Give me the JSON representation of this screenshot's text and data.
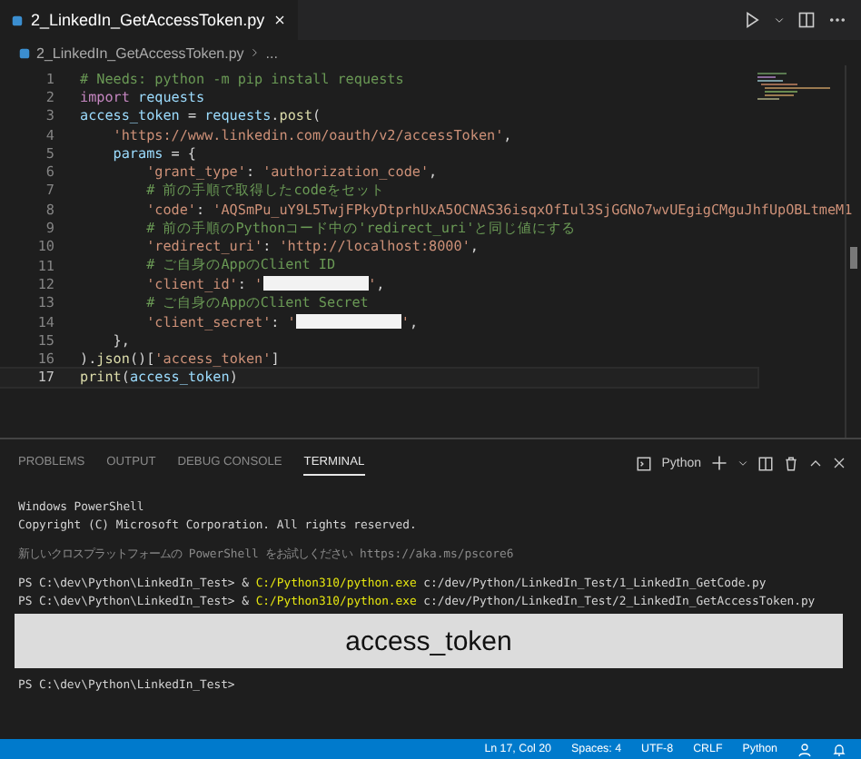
{
  "editor_tab": {
    "title": "2_LinkedIn_GetAccessToken.py",
    "selected": true
  },
  "breadcrumb": {
    "file": "2_LinkedIn_GetAccessToken.py",
    "more": "..."
  },
  "code_lines": [
    {
      "number": "1",
      "current": false,
      "parts": [
        {
          "kind": "comment",
          "text": "# Needs: python -m pip install requests"
        }
      ]
    },
    {
      "number": "2",
      "current": false,
      "parts": [
        {
          "kind": "keyword",
          "text": "import"
        },
        {
          "kind": "space"
        },
        {
          "kind": "name",
          "text": "requests"
        }
      ]
    },
    {
      "number": "3",
      "current": false,
      "parts": [
        {
          "kind": "name",
          "text": "access_token"
        },
        {
          "kind": "plain",
          "text": " = "
        },
        {
          "kind": "name",
          "text": "requests"
        },
        {
          "kind": "plain",
          "text": "."
        },
        {
          "kind": "function",
          "text": "post"
        },
        {
          "kind": "plain",
          "text": "("
        }
      ]
    },
    {
      "number": "4",
      "current": false,
      "parts": [
        {
          "kind": "indent"
        },
        {
          "kind": "string",
          "text": "'https://www.linkedin.com/oauth/v2/accessToken'"
        },
        {
          "kind": "plain",
          "text": ","
        }
      ]
    },
    {
      "number": "5",
      "current": false,
      "parts": [
        {
          "kind": "indent"
        },
        {
          "kind": "name",
          "text": "params"
        },
        {
          "kind": "plain",
          "text": " = {"
        }
      ]
    },
    {
      "number": "6",
      "current": false,
      "parts": [
        {
          "kind": "indent"
        },
        {
          "kind": "indent"
        },
        {
          "kind": "string",
          "text": "'grant_type'"
        },
        {
          "kind": "plain",
          "text": ": "
        },
        {
          "kind": "string",
          "text": "'authorization_code'"
        },
        {
          "kind": "plain",
          "text": ","
        }
      ]
    },
    {
      "number": "7",
      "current": false,
      "parts": [
        {
          "kind": "indent"
        },
        {
          "kind": "indent"
        },
        {
          "kind": "comment",
          "text": "# 前の手順で取得したcodeをセット"
        }
      ]
    },
    {
      "number": "8",
      "current": false,
      "parts": [
        {
          "kind": "indent"
        },
        {
          "kind": "indent"
        },
        {
          "kind": "string",
          "text": "'code'"
        },
        {
          "kind": "plain",
          "text": ": "
        },
        {
          "kind": "string",
          "text": "'AQSmPu_uY9L5TwjFPkyDtprhUxA5OCNAS36isqxOfIul3SjGGNo7wvUEgigCMguJhfUpOBLtmeM1"
        }
      ]
    },
    {
      "number": "9",
      "current": false,
      "parts": [
        {
          "kind": "indent"
        },
        {
          "kind": "indent"
        },
        {
          "kind": "comment",
          "text": "# 前の手順のPythonコード中の'redirect_uri'と同じ値にする"
        }
      ]
    },
    {
      "number": "10",
      "current": false,
      "parts": [
        {
          "kind": "indent"
        },
        {
          "kind": "indent"
        },
        {
          "kind": "string",
          "text": "'redirect_uri'"
        },
        {
          "kind": "plain",
          "text": ": "
        },
        {
          "kind": "string",
          "text": "'http://localhost:8000'"
        },
        {
          "kind": "plain",
          "text": ","
        }
      ]
    },
    {
      "number": "11",
      "current": false,
      "parts": [
        {
          "kind": "indent"
        },
        {
          "kind": "indent"
        },
        {
          "kind": "comment",
          "text": "# ご自身のAppのClient ID"
        }
      ]
    },
    {
      "number": "12",
      "current": false,
      "parts": [
        {
          "kind": "indent"
        },
        {
          "kind": "indent"
        },
        {
          "kind": "string",
          "text": "'client_id'"
        },
        {
          "kind": "plain",
          "text": ": "
        },
        {
          "kind": "string",
          "text": "'"
        },
        {
          "kind": "redacted"
        },
        {
          "kind": "string",
          "text": "'"
        },
        {
          "kind": "plain",
          "text": ","
        }
      ]
    },
    {
      "number": "13",
      "current": false,
      "parts": [
        {
          "kind": "indent"
        },
        {
          "kind": "indent"
        },
        {
          "kind": "comment",
          "text": "# ご自身のAppのClient Secret"
        }
      ]
    },
    {
      "number": "14",
      "current": false,
      "parts": [
        {
          "kind": "indent"
        },
        {
          "kind": "indent"
        },
        {
          "kind": "string",
          "text": "'client_secret'"
        },
        {
          "kind": "plain",
          "text": ": "
        },
        {
          "kind": "string",
          "text": "'"
        },
        {
          "kind": "redacted"
        },
        {
          "kind": "string",
          "text": "'"
        },
        {
          "kind": "plain",
          "text": ","
        }
      ]
    },
    {
      "number": "15",
      "current": false,
      "parts": [
        {
          "kind": "indent"
        },
        {
          "kind": "plain",
          "text": "},"
        }
      ]
    },
    {
      "number": "16",
      "current": false,
      "parts": [
        {
          "kind": "plain",
          "text": ")."
        },
        {
          "kind": "function",
          "text": "json"
        },
        {
          "kind": "plain",
          "text": "()["
        },
        {
          "kind": "string",
          "text": "'access_token'"
        },
        {
          "kind": "plain",
          "text": "]"
        }
      ]
    },
    {
      "number": "17",
      "current": true,
      "parts": [
        {
          "kind": "function",
          "text": "print"
        },
        {
          "kind": "plain",
          "text": "("
        },
        {
          "kind": "name",
          "text": "access_token"
        },
        {
          "kind": "plain",
          "text": ")"
        }
      ]
    }
  ],
  "panel_tabs": [
    {
      "label": "PROBLEMS",
      "selected": false
    },
    {
      "label": "OUTPUT",
      "selected": false
    },
    {
      "label": "DEBUG CONSOLE",
      "selected": false
    },
    {
      "label": "TERMINAL",
      "selected": true
    }
  ],
  "terminal_profile": "Python",
  "terminal_lines": [
    {
      "kind": "text",
      "parts": [
        {
          "kind": "plain",
          "text": "Windows PowerShell"
        }
      ]
    },
    {
      "kind": "text",
      "parts": [
        {
          "kind": "plain",
          "text": "Copyright (C) Microsoft Corporation. All rights reserved."
        }
      ]
    },
    {
      "kind": "gap"
    },
    {
      "kind": "text",
      "parts": [
        {
          "kind": "dim",
          "text": "新しいクロスプラットフォームの PowerShell をお試しください https://aka.ms/pscore6"
        }
      ]
    },
    {
      "kind": "gap"
    },
    {
      "kind": "text",
      "parts": [
        {
          "kind": "plain",
          "text": "PS C:\\dev\\Python\\LinkedIn_Test> & "
        },
        {
          "kind": "exe",
          "text": "C:/Python310/python.exe"
        },
        {
          "kind": "plain",
          "text": " c:/dev/Python/LinkedIn_Test/1_LinkedIn_GetCode.py"
        }
      ]
    },
    {
      "kind": "text",
      "parts": [
        {
          "kind": "plain",
          "text": "PS C:\\dev\\Python\\LinkedIn_Test> & "
        },
        {
          "kind": "exe",
          "text": "C:/Python310/python.exe"
        },
        {
          "kind": "plain",
          "text": " c:/dev/Python/LinkedIn_Test/2_LinkedIn_GetAccessToken.py"
        }
      ]
    },
    {
      "kind": "covered",
      "label": "access_token"
    },
    {
      "kind": "text",
      "parts": [
        {
          "kind": "plain",
          "text": "PS C:\\dev\\Python\\LinkedIn_Test>"
        }
      ]
    }
  ],
  "status_bar": [
    "Ln 17, Col 20",
    "Spaces: 4",
    "UTF-8",
    "CRLF",
    "Python"
  ]
}
